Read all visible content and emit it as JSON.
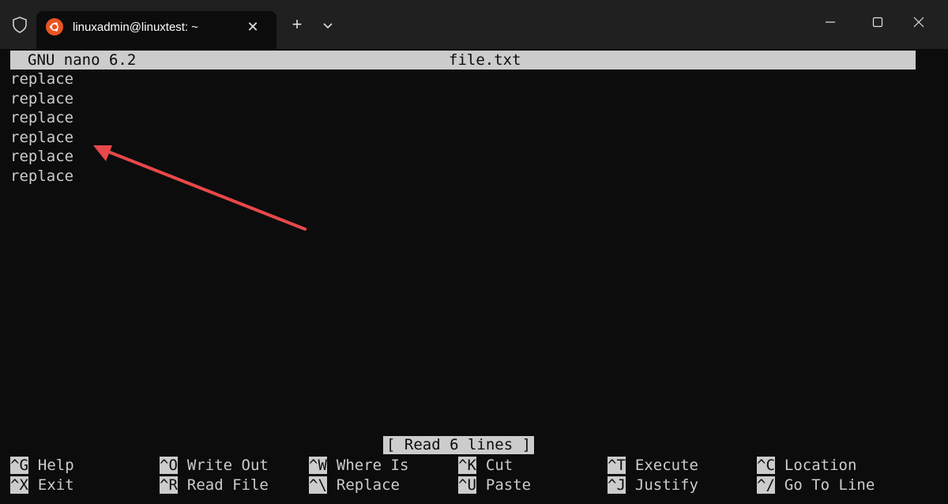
{
  "window": {
    "tab_title": "linuxadmin@linuxtest: ~",
    "tab_close": "✕",
    "new_tab": "+",
    "accent_color": "#e95420"
  },
  "nano": {
    "version": "GNU nano 6.2",
    "filename": "file.txt",
    "lines": [
      "replace",
      "replace",
      "replace",
      "replace",
      "replace",
      "replace"
    ],
    "status": "[ Read 6 lines ]"
  },
  "shortcuts": [
    {
      "key": "^G",
      "label": "Help"
    },
    {
      "key": "^X",
      "label": "Exit"
    },
    {
      "key": "^O",
      "label": "Write Out"
    },
    {
      "key": "^R",
      "label": "Read File"
    },
    {
      "key": "^W",
      "label": "Where Is"
    },
    {
      "key": "^\\",
      "label": "Replace"
    },
    {
      "key": "^K",
      "label": "Cut"
    },
    {
      "key": "^U",
      "label": "Paste"
    },
    {
      "key": "^T",
      "label": "Execute"
    },
    {
      "key": "^J",
      "label": "Justify"
    },
    {
      "key": "^C",
      "label": "Location"
    },
    {
      "key": "^/",
      "label": "Go To Line"
    }
  ],
  "annotation": {
    "arrow_color": "#e8484a"
  }
}
